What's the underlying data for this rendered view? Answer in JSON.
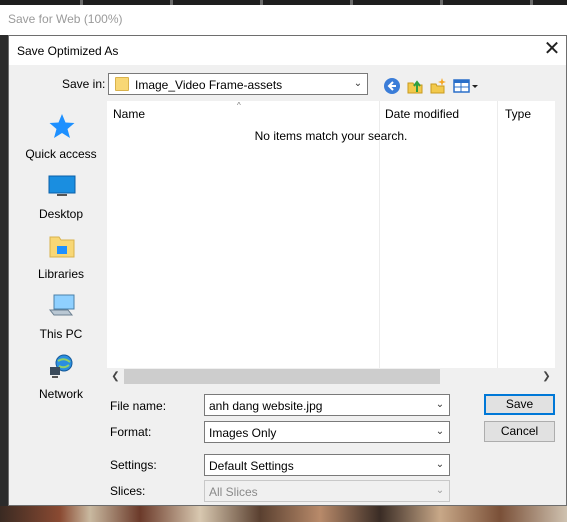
{
  "app": {
    "title": "Save for Web (100%)"
  },
  "dialog": {
    "title": "Save Optimized As",
    "save_in_label": "Save in:",
    "save_in_value": "Image_Video Frame-assets",
    "sidebar": [
      {
        "label": "Quick access",
        "icon": "star-icon"
      },
      {
        "label": "Desktop",
        "icon": "desktop-icon"
      },
      {
        "label": "Libraries",
        "icon": "libraries-icon"
      },
      {
        "label": "This PC",
        "icon": "computer-icon"
      },
      {
        "label": "Network",
        "icon": "network-icon"
      }
    ],
    "columns": [
      "Name",
      "Date modified",
      "Type"
    ],
    "empty_message": "No items match your search.",
    "file_name_label": "File name:",
    "file_name_value": "anh dang website.jpg",
    "format_label": "Format:",
    "format_value": "Images Only",
    "settings_label": "Settings:",
    "settings_value": "Default Settings",
    "slices_label": "Slices:",
    "slices_value": "All Slices",
    "save_button": "Save",
    "cancel_button": "Cancel"
  },
  "colors": {
    "accent": "#0078d7",
    "folder": "#f8d775",
    "background_window": "#f0f0f0"
  }
}
